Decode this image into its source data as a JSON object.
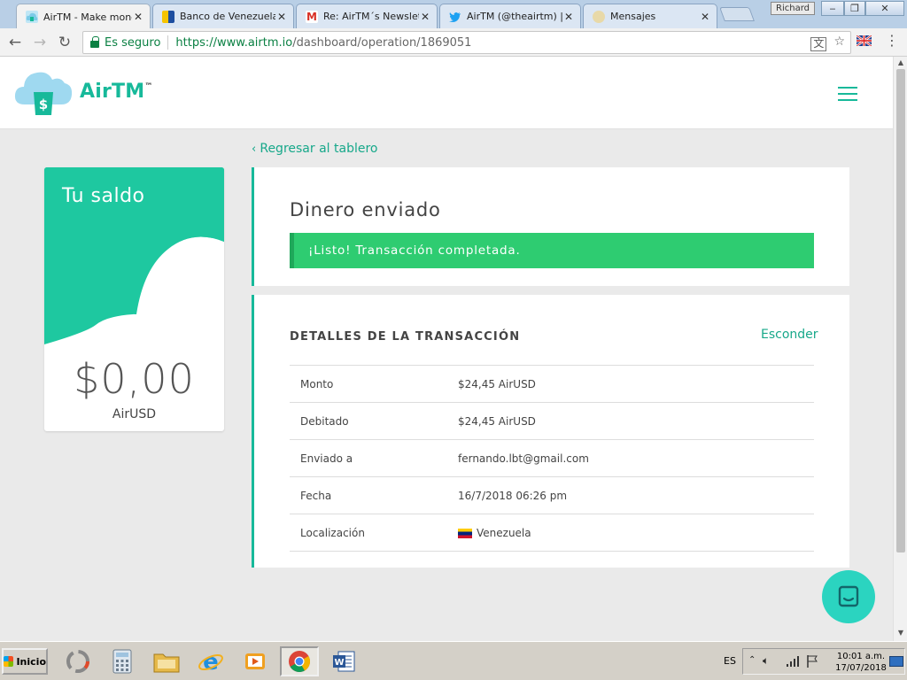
{
  "browser": {
    "tabs": [
      {
        "title": "AirTM - Make money",
        "active": true
      },
      {
        "title": "Banco de Venezuela",
        "active": false
      },
      {
        "title": "Re: AirTM´s Newslett",
        "active": false
      },
      {
        "title": "AirTM (@theairtm) | T",
        "active": false
      },
      {
        "title": "Mensajes",
        "active": false
      }
    ],
    "tab_close": "✕",
    "profile_name": "Richard",
    "secure_label": "Es seguro",
    "url_host": "https://www.airtm.io",
    "url_path": "/dashboard/operation/1869051"
  },
  "header": {
    "logo_text": "AirTM",
    "logo_tm": "™"
  },
  "nav": {
    "back_label": "Regresar al tablero"
  },
  "balance": {
    "title": "Tu saldo",
    "amount": "$0,00",
    "currency": "AirUSD"
  },
  "status": {
    "title": "Dinero enviado",
    "message": "¡Listo! Transacción completada."
  },
  "details": {
    "title": "DETALLES DE LA TRANSACCIÓN",
    "hide_label": "Esconder",
    "rows": [
      {
        "label": "Monto",
        "value": "$24,45 AirUSD"
      },
      {
        "label": "Debitado",
        "value": "$24,45 AirUSD"
      },
      {
        "label": "Enviado a",
        "value": "fernando.lbt@gmail.com"
      },
      {
        "label": "Fecha",
        "value": "16/7/2018 06:26 pm"
      },
      {
        "label": "Localización",
        "value": "Venezuela"
      }
    ]
  },
  "taskbar": {
    "start_label": "Inicio",
    "language": "ES",
    "clock_time": "10:01 a.m.",
    "clock_date": "17/07/2018"
  },
  "colors": {
    "brand": "#17b99a",
    "success": "#2ecc71",
    "chat": "#2bd4c0"
  }
}
